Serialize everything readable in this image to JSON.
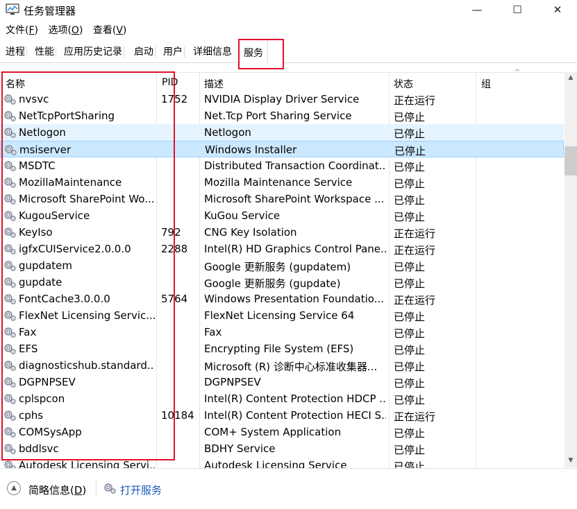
{
  "window": {
    "title": "任务管理器",
    "minimize": "—",
    "maximize": "☐",
    "close": "✕"
  },
  "menu": [
    {
      "label": "文件(",
      "key": "F",
      "end": ")"
    },
    {
      "label": "选项(",
      "key": "O",
      "end": ")"
    },
    {
      "label": "查看(",
      "key": "V",
      "end": ")"
    }
  ],
  "tabs": [
    "进程",
    "性能",
    "应用历史记录",
    "启动",
    "用户",
    "详细信息"
  ],
  "active_tab": "服务",
  "columns": {
    "name": "名称",
    "pid": "PID",
    "desc": "描述",
    "status": "状态",
    "group": "组"
  },
  "rows": [
    {
      "name": "nvsvc",
      "pid": "1752",
      "desc": "NVIDIA Display Driver Service",
      "status": "正在运行"
    },
    {
      "name": "NetTcpPortSharing",
      "pid": "",
      "desc": "Net.Tcp Port Sharing Service",
      "status": "已停止"
    },
    {
      "name": "Netlogon",
      "pid": "",
      "desc": "Netlogon",
      "status": "已停止"
    },
    {
      "name": "msiserver",
      "pid": "",
      "desc": "Windows Installer",
      "status": "已停止"
    },
    {
      "name": "MSDTC",
      "pid": "",
      "desc": "Distributed Transaction Coordinat...",
      "status": "已停止"
    },
    {
      "name": "MozillaMaintenance",
      "pid": "",
      "desc": "Mozilla Maintenance Service",
      "status": "已停止"
    },
    {
      "name": "Microsoft SharePoint Wo...",
      "pid": "",
      "desc": "Microsoft SharePoint Workspace ...",
      "status": "已停止"
    },
    {
      "name": "KugouService",
      "pid": "",
      "desc": "KuGou Service",
      "status": "已停止"
    },
    {
      "name": "KeyIso",
      "pid": "792",
      "desc": "CNG Key Isolation",
      "status": "正在运行"
    },
    {
      "name": "igfxCUIService2.0.0.0",
      "pid": "2288",
      "desc": "Intel(R) HD Graphics Control Pane...",
      "status": "正在运行"
    },
    {
      "name": "gupdatem",
      "pid": "",
      "desc": "Google 更新服务 (gupdatem)",
      "status": "已停止"
    },
    {
      "name": "gupdate",
      "pid": "",
      "desc": "Google 更新服务 (gupdate)",
      "status": "已停止"
    },
    {
      "name": "FontCache3.0.0.0",
      "pid": "5764",
      "desc": "Windows Presentation Foundatio...",
      "status": "正在运行"
    },
    {
      "name": "FlexNet Licensing Servic...",
      "pid": "",
      "desc": "FlexNet Licensing Service 64",
      "status": "已停止"
    },
    {
      "name": "Fax",
      "pid": "",
      "desc": "Fax",
      "status": "已停止"
    },
    {
      "name": "EFS",
      "pid": "",
      "desc": "Encrypting File System (EFS)",
      "status": "已停止"
    },
    {
      "name": "diagnosticshub.standard...",
      "pid": "",
      "desc": "Microsoft (R) 诊断中心标准收集器...",
      "status": "已停止"
    },
    {
      "name": "DGPNPSEV",
      "pid": "",
      "desc": "DGPNPSEV",
      "status": "已停止"
    },
    {
      "name": "cplspcon",
      "pid": "",
      "desc": "Intel(R) Content Protection HDCP ...",
      "status": "已停止"
    },
    {
      "name": "cphs",
      "pid": "10184",
      "desc": "Intel(R) Content Protection HECI S...",
      "status": "正在运行"
    },
    {
      "name": "COMSysApp",
      "pid": "",
      "desc": "COM+ System Application",
      "status": "已停止"
    },
    {
      "name": "bddlsvc",
      "pid": "",
      "desc": "BDHY Service",
      "status": "已停止"
    },
    {
      "name": "Autodesk Licensing Servi...",
      "pid": "",
      "desc": "Autodesk Licensing Service",
      "status": "已停止"
    }
  ],
  "hover_row": 2,
  "selected_row": 3,
  "footer": {
    "brief_label": "简略信息(",
    "brief_key": "D",
    "brief_end": ")",
    "open_services": "打开服务"
  }
}
